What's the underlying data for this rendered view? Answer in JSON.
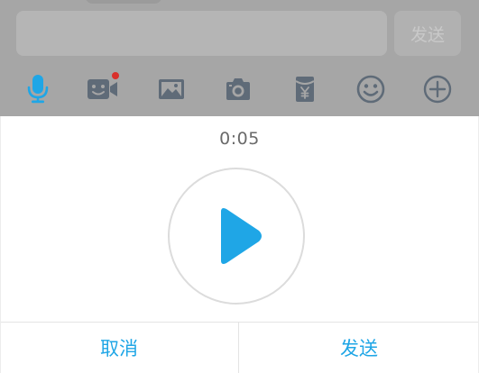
{
  "input_bar": {
    "message_value": "",
    "send_label": "发送"
  },
  "toolbar": {
    "icons": [
      "microphone-icon",
      "video-call-icon",
      "image-icon",
      "camera-icon",
      "red-envelope-icon",
      "emoji-icon",
      "plus-icon"
    ],
    "notification_dot": true
  },
  "recorder": {
    "elapsed_time": "0:05",
    "play_icon": "play-icon"
  },
  "actions": {
    "cancel_label": "取消",
    "send_label": "发送"
  },
  "colors": {
    "accent": "#1fa6e6",
    "dimmed_icon": "#5f6b78",
    "notification_dot": "#d9302b",
    "overlay": "#a6a6a6"
  }
}
